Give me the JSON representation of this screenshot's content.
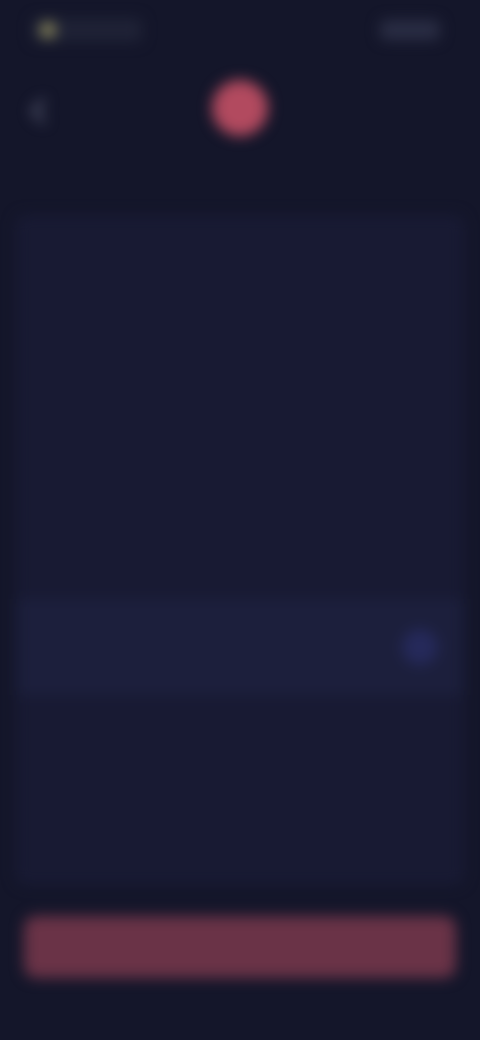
{
  "status_bar": {
    "left_indicator": "",
    "right_indicator": ""
  },
  "header": {
    "back_icon": "chevron-left-icon",
    "logo_icon": "app-logo-icon",
    "title": ""
  },
  "options": [
    {
      "label": "",
      "selected": false
    },
    {
      "label": "",
      "selected": false
    },
    {
      "label": "",
      "selected": false
    },
    {
      "label": "",
      "selected": false
    },
    {
      "label": "",
      "selected": true
    },
    {
      "label": "",
      "selected": false
    },
    {
      "label": "",
      "selected": false
    }
  ],
  "submit": {
    "label": ""
  },
  "colors": {
    "background": "#14162a",
    "accent": "#b24a5f",
    "button": "#6a3347",
    "selected_radio": "#25295a"
  }
}
